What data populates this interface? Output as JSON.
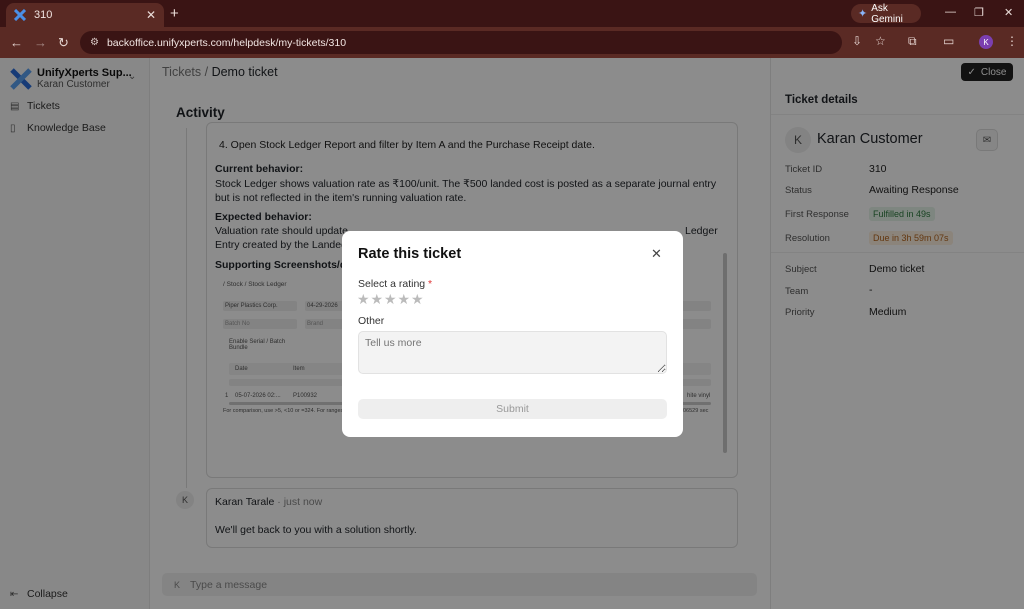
{
  "browser": {
    "tab_title": "310",
    "url": "backoffice.unifyxperts.com/helpdesk/my-tickets/310",
    "gemini_label": "Ask Gemini",
    "profile_initial": "K"
  },
  "sidebar": {
    "org_name": "UnifyXperts Sup...",
    "user_name": "Karan Customer",
    "items": [
      {
        "label": "Tickets"
      },
      {
        "label": "Knowledge Base"
      }
    ],
    "collapse_label": "Collapse"
  },
  "header": {
    "crumb_parent": "Tickets",
    "crumb_sep": "/",
    "crumb_current": "Demo ticket",
    "close_label": "Close"
  },
  "activity": {
    "title": "Activity",
    "step": "4.   Open Stock Ledger Report and filter by Item A and the Purchase Receipt date.",
    "current_heading": "Current behavior:",
    "current_text": "Stock Ledger shows valuation rate as ₹100/unit. The ₹500 landed cost is posted as a separate journal entry but is not reflected in the item's running valuation rate.",
    "expected_heading": "Expected behavior:",
    "expected_text_left": "Valuation rate should update",
    "expected_text_right": "Ledger",
    "expected_text_line2": "Entry created by the Landed",
    "supporting_heading": "Supporting Screenshots/do",
    "screenshot": {
      "crumb": "/ Stock / Stock Ledger",
      "company": "Piper Plastics Corp.",
      "date": "04-29-2026",
      "batch": "Batch No",
      "brand": "Brand",
      "serial": "Enable Serial / Batch Bundle",
      "col_date": "Date",
      "col_item": "Item",
      "row_idx": "1",
      "row_date": "05-07-2026 02:...",
      "row_item": "P100932",
      "row_right": "hite vinyl",
      "footer": "For comparison, use >5, <10 or =324. For ranges, u",
      "footer_right": "06529 sec"
    }
  },
  "reply": {
    "avatar": "K",
    "author": "Karan Tarale",
    "time": " · just now",
    "message": "We'll get back to you with a solution shortly."
  },
  "composer": {
    "avatar": "K",
    "placeholder": "Type a message"
  },
  "details": {
    "title": "Ticket details",
    "avatar": "K",
    "customer": "Karan Customer",
    "fields": {
      "ticket_id_label": "Ticket ID",
      "ticket_id": "310",
      "status_label": "Status",
      "status": "Awaiting Response",
      "first_response_label": "First Response",
      "first_response": "Fulfilled in 49s",
      "resolution_label": "Resolution",
      "resolution": "Due in 3h 59m 07s",
      "subject_label": "Subject",
      "subject": "Demo ticket",
      "team_label": "Team",
      "team": "-",
      "priority_label": "Priority",
      "priority": "Medium"
    },
    "colors": {
      "fulfilled": "#2d7a3e",
      "due": "#b5651d"
    }
  },
  "modal": {
    "title": "Rate this ticket",
    "rating_label": "Select a rating",
    "required_mark": "*",
    "stars_total": 5,
    "stars_selected": 0,
    "other_label": "Other",
    "textarea_placeholder": "Tell us more",
    "submit_label": "Submit"
  }
}
